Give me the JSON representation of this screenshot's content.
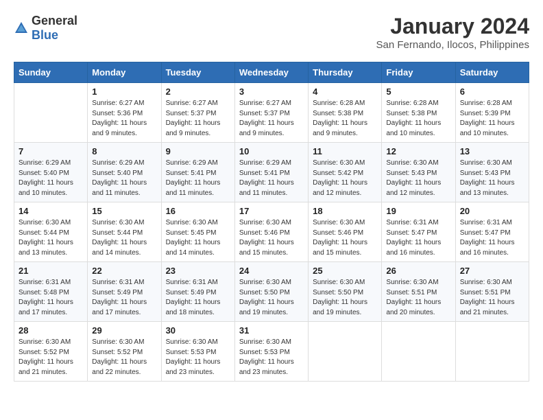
{
  "logo": {
    "general": "General",
    "blue": "Blue"
  },
  "header": {
    "month": "January 2024",
    "location": "San Fernando, Ilocos, Philippines"
  },
  "weekdays": [
    "Sunday",
    "Monday",
    "Tuesday",
    "Wednesday",
    "Thursday",
    "Friday",
    "Saturday"
  ],
  "weeks": [
    [
      {
        "day": "",
        "detail": ""
      },
      {
        "day": "1",
        "detail": "Sunrise: 6:27 AM\nSunset: 5:36 PM\nDaylight: 11 hours\nand 9 minutes."
      },
      {
        "day": "2",
        "detail": "Sunrise: 6:27 AM\nSunset: 5:37 PM\nDaylight: 11 hours\nand 9 minutes."
      },
      {
        "day": "3",
        "detail": "Sunrise: 6:27 AM\nSunset: 5:37 PM\nDaylight: 11 hours\nand 9 minutes."
      },
      {
        "day": "4",
        "detail": "Sunrise: 6:28 AM\nSunset: 5:38 PM\nDaylight: 11 hours\nand 9 minutes."
      },
      {
        "day": "5",
        "detail": "Sunrise: 6:28 AM\nSunset: 5:38 PM\nDaylight: 11 hours\nand 10 minutes."
      },
      {
        "day": "6",
        "detail": "Sunrise: 6:28 AM\nSunset: 5:39 PM\nDaylight: 11 hours\nand 10 minutes."
      }
    ],
    [
      {
        "day": "7",
        "detail": "Sunrise: 6:29 AM\nSunset: 5:40 PM\nDaylight: 11 hours\nand 10 minutes."
      },
      {
        "day": "8",
        "detail": "Sunrise: 6:29 AM\nSunset: 5:40 PM\nDaylight: 11 hours\nand 11 minutes."
      },
      {
        "day": "9",
        "detail": "Sunrise: 6:29 AM\nSunset: 5:41 PM\nDaylight: 11 hours\nand 11 minutes."
      },
      {
        "day": "10",
        "detail": "Sunrise: 6:29 AM\nSunset: 5:41 PM\nDaylight: 11 hours\nand 11 minutes."
      },
      {
        "day": "11",
        "detail": "Sunrise: 6:30 AM\nSunset: 5:42 PM\nDaylight: 11 hours\nand 12 minutes."
      },
      {
        "day": "12",
        "detail": "Sunrise: 6:30 AM\nSunset: 5:43 PM\nDaylight: 11 hours\nand 12 minutes."
      },
      {
        "day": "13",
        "detail": "Sunrise: 6:30 AM\nSunset: 5:43 PM\nDaylight: 11 hours\nand 13 minutes."
      }
    ],
    [
      {
        "day": "14",
        "detail": "Sunrise: 6:30 AM\nSunset: 5:44 PM\nDaylight: 11 hours\nand 13 minutes."
      },
      {
        "day": "15",
        "detail": "Sunrise: 6:30 AM\nSunset: 5:44 PM\nDaylight: 11 hours\nand 14 minutes."
      },
      {
        "day": "16",
        "detail": "Sunrise: 6:30 AM\nSunset: 5:45 PM\nDaylight: 11 hours\nand 14 minutes."
      },
      {
        "day": "17",
        "detail": "Sunrise: 6:30 AM\nSunset: 5:46 PM\nDaylight: 11 hours\nand 15 minutes."
      },
      {
        "day": "18",
        "detail": "Sunrise: 6:30 AM\nSunset: 5:46 PM\nDaylight: 11 hours\nand 15 minutes."
      },
      {
        "day": "19",
        "detail": "Sunrise: 6:31 AM\nSunset: 5:47 PM\nDaylight: 11 hours\nand 16 minutes."
      },
      {
        "day": "20",
        "detail": "Sunrise: 6:31 AM\nSunset: 5:47 PM\nDaylight: 11 hours\nand 16 minutes."
      }
    ],
    [
      {
        "day": "21",
        "detail": "Sunrise: 6:31 AM\nSunset: 5:48 PM\nDaylight: 11 hours\nand 17 minutes."
      },
      {
        "day": "22",
        "detail": "Sunrise: 6:31 AM\nSunset: 5:49 PM\nDaylight: 11 hours\nand 17 minutes."
      },
      {
        "day": "23",
        "detail": "Sunrise: 6:31 AM\nSunset: 5:49 PM\nDaylight: 11 hours\nand 18 minutes."
      },
      {
        "day": "24",
        "detail": "Sunrise: 6:30 AM\nSunset: 5:50 PM\nDaylight: 11 hours\nand 19 minutes."
      },
      {
        "day": "25",
        "detail": "Sunrise: 6:30 AM\nSunset: 5:50 PM\nDaylight: 11 hours\nand 19 minutes."
      },
      {
        "day": "26",
        "detail": "Sunrise: 6:30 AM\nSunset: 5:51 PM\nDaylight: 11 hours\nand 20 minutes."
      },
      {
        "day": "27",
        "detail": "Sunrise: 6:30 AM\nSunset: 5:51 PM\nDaylight: 11 hours\nand 21 minutes."
      }
    ],
    [
      {
        "day": "28",
        "detail": "Sunrise: 6:30 AM\nSunset: 5:52 PM\nDaylight: 11 hours\nand 21 minutes."
      },
      {
        "day": "29",
        "detail": "Sunrise: 6:30 AM\nSunset: 5:52 PM\nDaylight: 11 hours\nand 22 minutes."
      },
      {
        "day": "30",
        "detail": "Sunrise: 6:30 AM\nSunset: 5:53 PM\nDaylight: 11 hours\nand 23 minutes."
      },
      {
        "day": "31",
        "detail": "Sunrise: 6:30 AM\nSunset: 5:53 PM\nDaylight: 11 hours\nand 23 minutes."
      },
      {
        "day": "",
        "detail": ""
      },
      {
        "day": "",
        "detail": ""
      },
      {
        "day": "",
        "detail": ""
      }
    ]
  ]
}
